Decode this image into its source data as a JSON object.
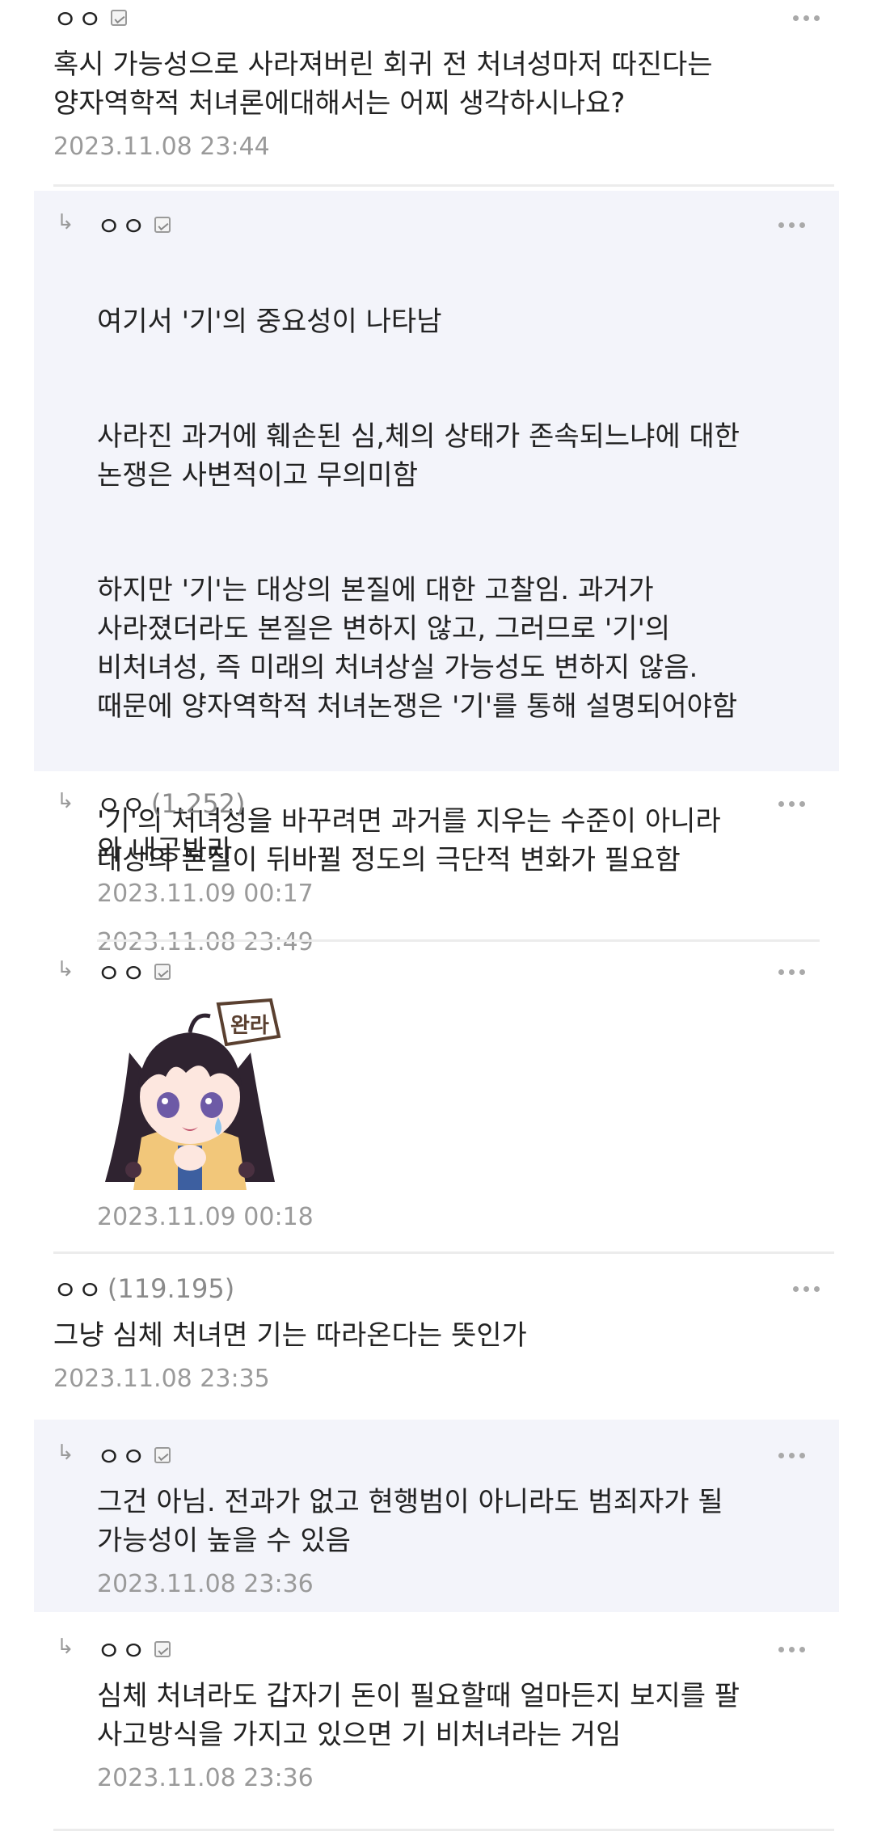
{
  "comments": [
    {
      "nick": "ㅇㅇ",
      "body": "혹시 가능성으로 사라져버린 회귀 전 처녀성마저 따진다는\n양자역학적 처녀론에대해서는 어찌 생각하시나요?",
      "time": "2023.11.08 23:44"
    },
    {
      "nick": "ㅇㅇ",
      "paragraphs": [
        "여기서 '기'의 중요성이 나타남",
        "사라진 과거에 훼손된 심,체의 상태가 존속되느냐에 대한\n논쟁은 사변적이고 무의미함",
        "하지만 '기'는 대상의 본질에 대한 고찰임. 과거가\n사라졌더라도 본질은 변하지 않고, 그러므로 '기'의\n비처녀성, 즉 미래의 처녀상실 가능성도 변하지 않음.\n때문에 양자역학적 처녀논쟁은 '기'를 통해 설명되어야함",
        "'기'의 처녀성을 바꾸려면 과거를 지우는 수준이 아니라\n대상의 본질이 뒤바뀔 정도의 극단적 변화가 필요함"
      ],
      "time": "2023.11.08 23:49"
    },
    {
      "nick": "ㅇㅇ",
      "ip": "(1.252)",
      "body": "와 내공봐라",
      "time": "2023.11.09 00:17"
    },
    {
      "nick": "ㅇㅇ",
      "sticker_text": "완라",
      "time": "2023.11.09 00:18"
    },
    {
      "nick": "ㅇㅇ",
      "ip": "(119.195)",
      "body": "그냥 심체 처녀면 기는 따라온다는 뜻인가",
      "time": "2023.11.08 23:35"
    },
    {
      "nick": "ㅇㅇ",
      "body": "그건 아님. 전과가 없고 현행범이 아니라도 범죄자가 될\n가능성이 높을 수 있음",
      "time": "2023.11.08 23:36"
    },
    {
      "nick": "ㅇㅇ",
      "body": "심체 처녀라도 갑자기 돈이 필요할때 얼마든지 보지를 팔\n사고방식을 가지고 있으면 기 비처녀라는 거임",
      "time": "2023.11.08 23:36"
    }
  ],
  "icons": {
    "reply_arrow": "↳",
    "more": "more-dots-icon",
    "badge": "fixed-nick-badge-icon"
  },
  "colors": {
    "highlight_bg": "#f3f4fa",
    "meta_text": "#9a9a9a",
    "sticker_hair": "#2f2330",
    "sticker_dress": "#f2c77a"
  }
}
